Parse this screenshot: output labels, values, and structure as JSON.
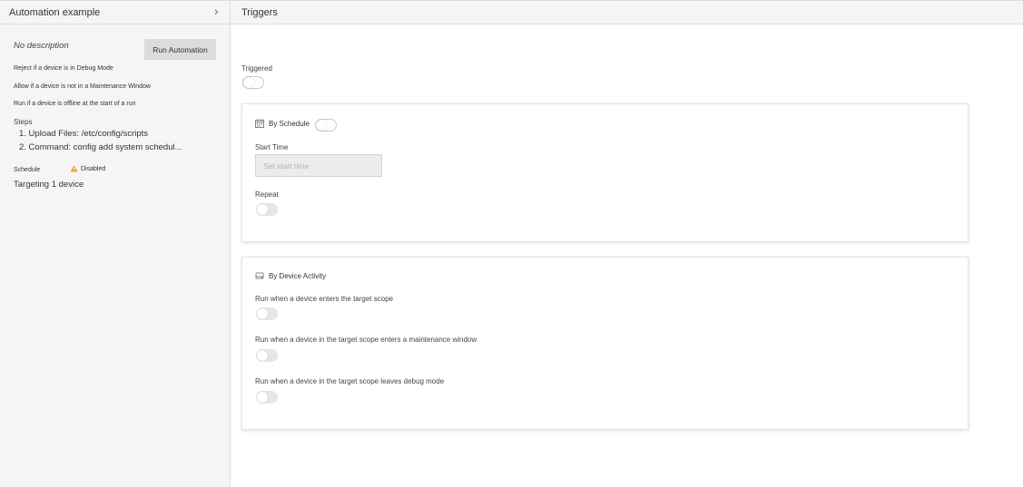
{
  "sidebar": {
    "title": "Automation example",
    "description": "No description",
    "run_button": "Run Automation",
    "conditions": [
      "Reject if a device is in Debug Mode",
      "Allow if a device is not in a Maintenance Window",
      "Run if a device is offline at the start of a run"
    ],
    "steps_label": "Steps",
    "steps": [
      "1. Upload Files: /etc/config/scripts",
      "2. Command: config add system schedul..."
    ],
    "schedule_label": "Schedule",
    "schedule_status": "Disabled",
    "targeting": "Targeting 1 device"
  },
  "main": {
    "title": "Triggers",
    "triggered_label": "Triggered",
    "schedule_card": {
      "title": "By Schedule",
      "start_time_label": "Start Time",
      "start_time_placeholder": "Set start time",
      "repeat_label": "Repeat"
    },
    "activity_card": {
      "title": "By Device Activity",
      "options": [
        "Run when a device enters the target scope",
        "Run when a device in the target scope enters a maintenance window",
        "Run when a device in the target scope leaves debug mode"
      ]
    }
  },
  "colors": {
    "sidebar_bg": "#f5f5f5",
    "button_bg": "#dcdcdc",
    "warning": "#f0a020",
    "toggle_off": "#e6e6e6"
  },
  "icons": {
    "expand": "chevron-right-icon",
    "schedule": "calendar-icon",
    "activity": "device-icon",
    "warning": "warning-icon"
  }
}
